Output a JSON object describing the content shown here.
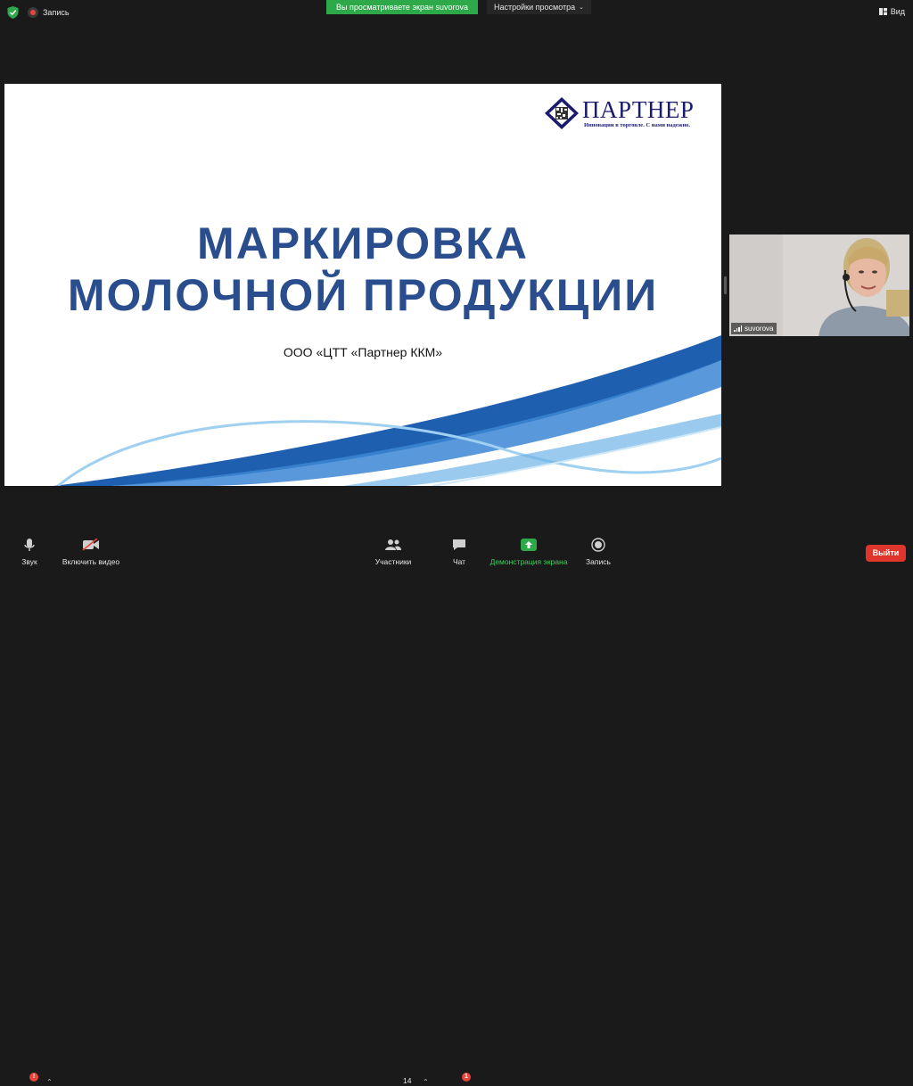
{
  "topbar": {
    "recording_label": "Запись",
    "share_banner": "Вы просматриваете экран suvorova",
    "view_settings_label": "Настройки просмотра",
    "view_label": "Вид"
  },
  "slide": {
    "logo_name": "ПАРТНЕР",
    "logo_tagline": "Инновации в торговле. С нами надежно.",
    "title_line1": "МАРКИРОВКА",
    "title_line2": "МОЛОЧНОЙ ПРОДУКЦИИ",
    "subtitle": "ООО «ЦТТ «Партнер ККМ»"
  },
  "participant": {
    "name": "suvorova"
  },
  "toolbar": {
    "audio_label": "Звук",
    "video_label": "Включить видео",
    "participants_label": "Участники",
    "participants_count": "14",
    "chat_label": "Чат",
    "chat_badge": "1",
    "audio_badge": "!",
    "share_label": "Демонстрация экрана",
    "record_label": "Запись",
    "leave_label": "Выйти"
  },
  "colors": {
    "background": "#1a1a1a",
    "share_green": "#2ea94a",
    "leave_red": "#e0352b",
    "title_blue": "#2a4e8d"
  },
  "icons": [
    "shield-icon",
    "record-icon",
    "view-icon",
    "microphone-icon",
    "video-off-icon",
    "participants-icon",
    "chat-icon",
    "share-screen-icon",
    "record-button-icon"
  ]
}
